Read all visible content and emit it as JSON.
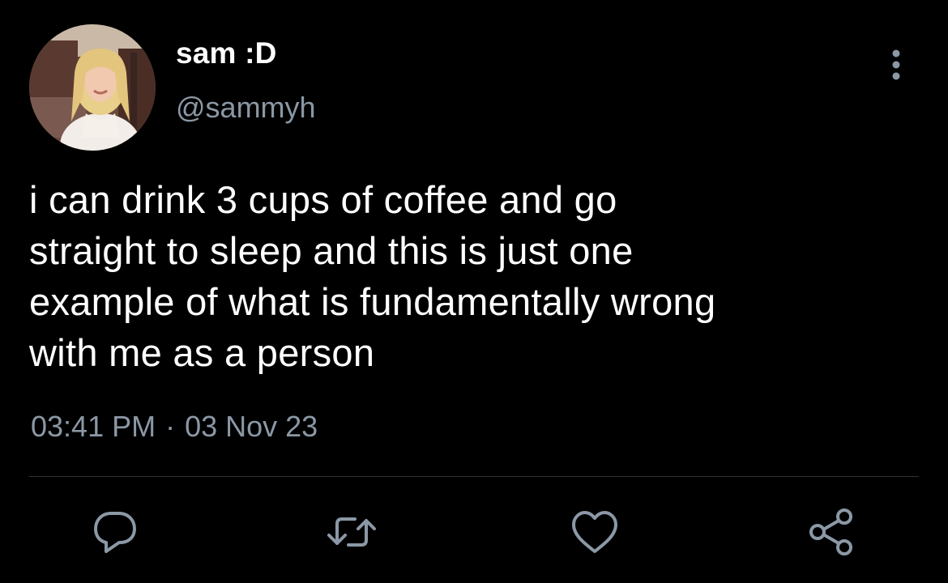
{
  "tweet": {
    "display_name": "sam :D",
    "handle": "@sammyh",
    "text": "i can drink 3 cups of coffee and go\nstraight to sleep and this is just one\nexample of what is fundamentally wrong\nwith me as a person",
    "time": "03:41 PM",
    "separator": "·",
    "date": "03 Nov 23"
  },
  "icons": {
    "more": "more-vertical-icon",
    "reply": "reply-icon",
    "retweet": "retweet-icon",
    "like": "heart-icon",
    "share": "share-icon"
  },
  "colors": {
    "background": "#000000",
    "text": "#ffffff",
    "secondary_text": "#8b98a5",
    "divider": "#2f3336",
    "icon": "#8b98a5"
  }
}
